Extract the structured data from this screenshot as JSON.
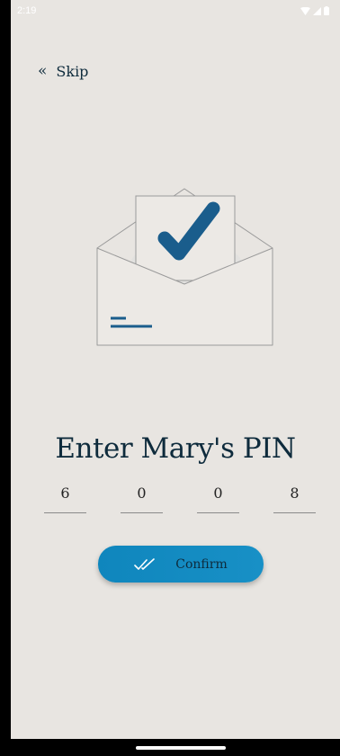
{
  "status_bar": {
    "time": "2:19"
  },
  "header": {
    "skip_label": "Skip"
  },
  "main": {
    "title": "Enter Mary's PIN",
    "pin_digits": [
      "6",
      "0",
      "0",
      "8"
    ],
    "confirm_label": "Confirm"
  },
  "colors": {
    "background": "#e8e5e1",
    "primary_text": "#0e2b3c",
    "accent": "#1890c6",
    "check": "#1a5d8c"
  },
  "icons": {
    "skip": "double-chevron-left-icon",
    "confirm": "double-check-icon",
    "illustration": "envelope-check-icon"
  }
}
